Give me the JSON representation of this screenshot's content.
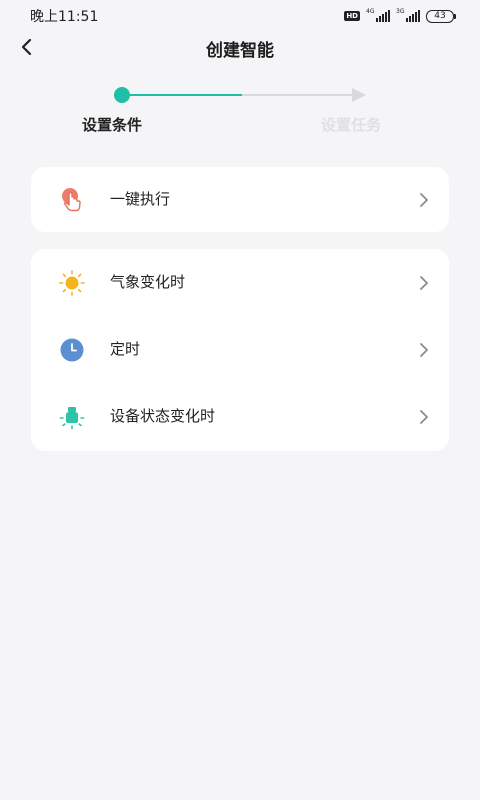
{
  "status_bar": {
    "time": "晚上11:51",
    "hd_label": "HD",
    "network_1": "4G",
    "network_2": "3G",
    "battery": "43"
  },
  "header": {
    "title": "创建智能",
    "back_icon": "chevron-left-icon"
  },
  "stepper": {
    "accent_color": "#1fbfa5",
    "steps": [
      {
        "label": "设置条件",
        "active": true
      },
      {
        "label": "设置任务",
        "active": false
      }
    ]
  },
  "groups": [
    {
      "items": [
        {
          "label": "一键执行",
          "icon": "tap-hand-icon",
          "icon_color": "#e8705a"
        }
      ]
    },
    {
      "items": [
        {
          "label": "气象变化时",
          "icon": "sun-icon",
          "icon_color": "#f5b31e"
        },
        {
          "label": "定时",
          "icon": "clock-icon",
          "icon_color": "#5b8fd1"
        },
        {
          "label": "设备状态变化时",
          "icon": "device-light-icon",
          "icon_color": "#2cc4a8"
        }
      ]
    }
  ]
}
